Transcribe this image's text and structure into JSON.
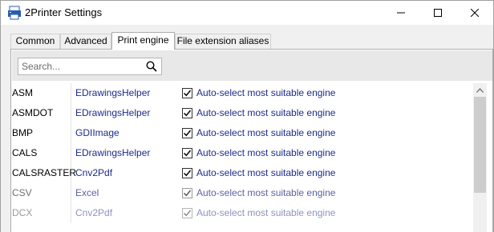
{
  "window": {
    "title": "2Printer Settings"
  },
  "tabs": [
    {
      "label": "Common",
      "active": false
    },
    {
      "label": "Advanced",
      "active": false
    },
    {
      "label": "Print engine",
      "active": true
    },
    {
      "label": "File extension aliases",
      "active": false
    }
  ],
  "search": {
    "placeholder": "Search...",
    "value": ""
  },
  "rows": [
    {
      "ext": "ASM",
      "helper": "EDrawingsHelper",
      "checked": true,
      "auto_label": "Auto-select most suitable engine"
    },
    {
      "ext": "ASMDOT",
      "helper": "EDrawingsHelper",
      "checked": true,
      "auto_label": "Auto-select most suitable engine"
    },
    {
      "ext": "BMP",
      "helper": "GDIImage",
      "checked": true,
      "auto_label": "Auto-select most suitable engine"
    },
    {
      "ext": "CALS",
      "helper": "EDrawingsHelper",
      "checked": true,
      "auto_label": "Auto-select most suitable engine"
    },
    {
      "ext": "CALSRASTER",
      "helper": "Cnv2Pdf",
      "checked": true,
      "auto_label": "Auto-select most suitable engine"
    },
    {
      "ext": "CSV",
      "helper": "Excel",
      "checked": true,
      "auto_label": "Auto-select most suitable engine"
    },
    {
      "ext": "DCX",
      "helper": "Cnv2Pdf",
      "checked": true,
      "auto_label": "Auto-select most suitable engine"
    }
  ],
  "icons": {
    "app": "printer-app-icon",
    "search": "search-icon",
    "minimize": "minimize-icon",
    "maximize": "maximize-icon",
    "close": "close-icon",
    "checkbox": "checkmark-icon",
    "scroll_up": "chevron-up-icon"
  },
  "colors": {
    "helper_text": "#1c2a8c",
    "window_bg": "#f0f0f0",
    "app_icon": "#2a5db0"
  }
}
